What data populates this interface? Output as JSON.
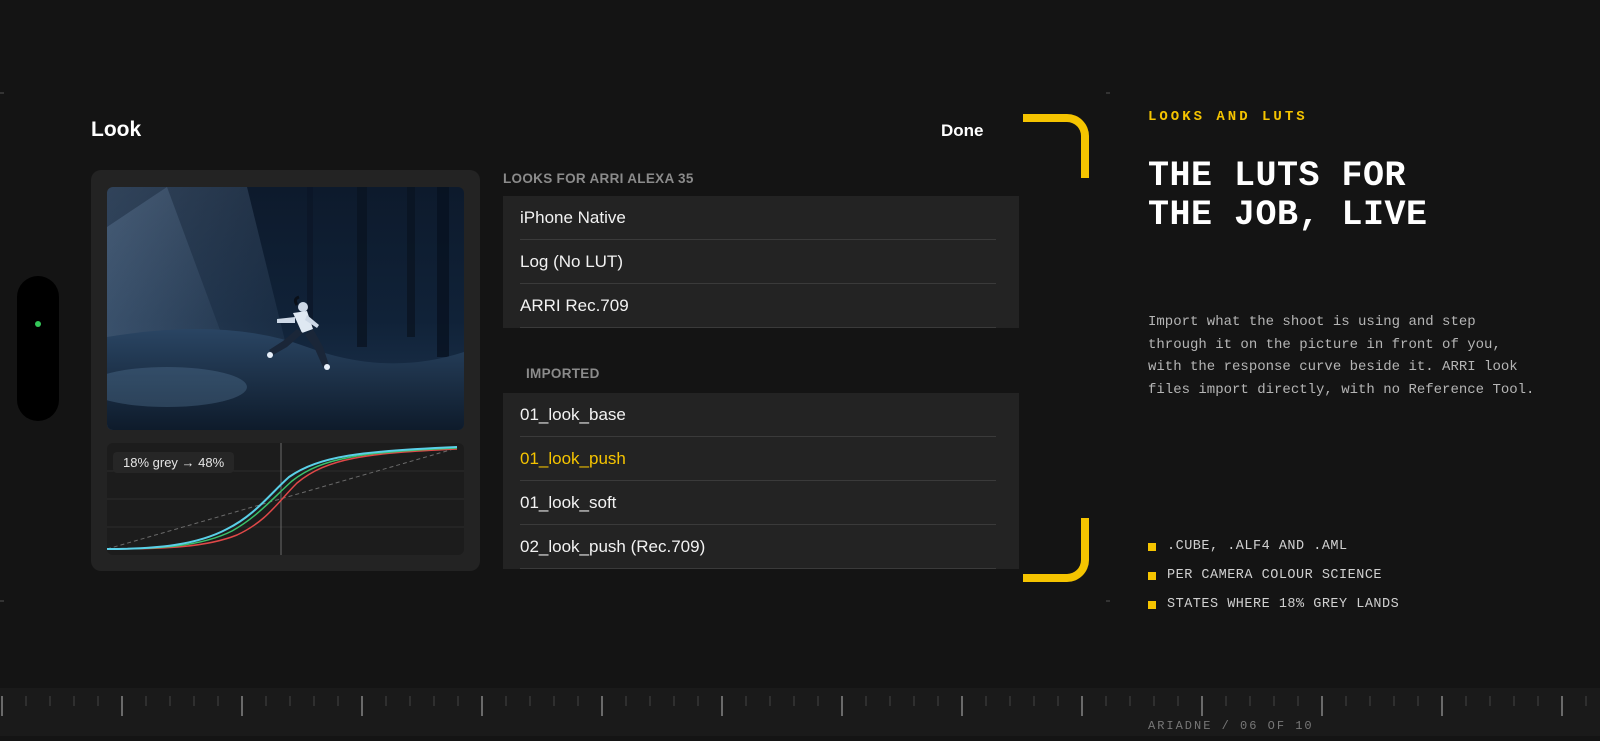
{
  "screen": {
    "title": "Look",
    "done_label": "Done"
  },
  "preview": {
    "curve_label": "18% grey → 48%"
  },
  "looks_section": {
    "label": "LOOKS FOR ARRI ALEXA 35",
    "items": [
      "iPhone Native",
      "Log (No LUT)",
      "ARRI Rec.709"
    ]
  },
  "imported_section": {
    "label": "IMPORTED",
    "items": [
      "01_look_base",
      "01_look_push",
      "01_look_soft",
      "02_look_push (Rec.709)"
    ],
    "selected": "01_look_push"
  },
  "copy": {
    "eyebrow": "LOOKS AND LUTS",
    "headline_line1": "THE LUTS FOR",
    "headline_line2": "THE JOB, LIVE",
    "body": "Import what the shoot is using and step through it on the picture in front of you, with the response curve beside it. ARRI look files import directly, with no Reference Tool.",
    "bullets": [
      ".CUBE, .ALF4 AND .AML",
      "PER CAMERA COLOUR SCIENCE",
      "STATES WHERE 18% GREY LANDS"
    ]
  },
  "footer": {
    "text": "ARIADNE / 06 OF 10"
  },
  "colors": {
    "accent": "#f5c400",
    "background": "#141414",
    "panel": "#232323",
    "status_dot": "#34c759"
  }
}
